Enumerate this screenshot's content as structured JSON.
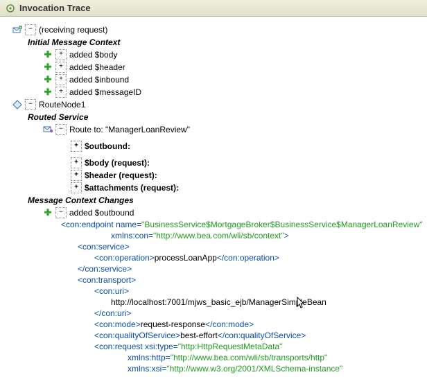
{
  "title": "Invocation Trace",
  "tree": {
    "receiving_request": "(receiving request)",
    "initial_msg_ctx": "Initial Message Context",
    "added_body": "added $body",
    "added_header": "added $header",
    "added_inbound": "added $inbound",
    "added_messageid": "added $messageID",
    "routenode1": "RouteNode1",
    "routed_service": "Routed Service",
    "route_to": "Route to: \"ManagerLoanReview\"",
    "outbound": "$outbound:",
    "body_req": "$body  (request):",
    "header_req": "$header  (request):",
    "attach_req": "$attachments  (request):",
    "msg_ctx_changes": "Message Context Changes",
    "added_outbound": "added $outbound"
  },
  "xml": {
    "endpoint_open_a": "<con:endpoint",
    "endpoint_name_k": " name",
    "endpoint_name_v": "\"BusinessService$MortgageBroker$BusinessService$ManagerLoanReview\"",
    "endpoint_xmlns_k": "xmlns:con",
    "endpoint_xmlns_v": "\"http://www.bea.com/wli/sb/context\"",
    "service_open": "<con:service>",
    "operation_open": "<con:operation>",
    "operation_text": "processLoanApp",
    "operation_close": "</con:operation>",
    "service_close": "</con:service>",
    "transport_open": "<con:transport>",
    "uri_open": "<con:uri>",
    "uri_text": "http://localhost:7001/mjws_basic_ejb/ManagerSimpleBean",
    "uri_close": "</con:uri>",
    "mode_open": "<con:mode>",
    "mode_text": "request-response",
    "mode_close": "</con:mode>",
    "qos_open": "<con:qualityOfService>",
    "qos_text": "best-effort",
    "qos_close": "</con:qualityOfService>",
    "request_open": "<con:request",
    "request_xsi_k": " xsi:type",
    "request_xsi_v": "\"http:HttpRequestMetaData\"",
    "request_http_k": "xmlns:http",
    "request_http_v": "\"http://www.bea.com/wli/sb/transports/http\"",
    "request_xsi2_k": "xmlns:xsi",
    "request_xsi2_v": "\"http://www.w3.org/2001/XMLSchema-instance\""
  }
}
